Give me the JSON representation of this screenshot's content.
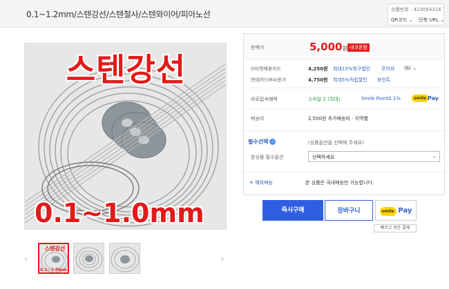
{
  "header": {
    "title": "0.1~1.2mm/스텐강선/스텐철사/스텐와이어/피아노선",
    "product_no": "상품번호 : 423054316",
    "qr_label": "QR코드 ⌄",
    "url_label": "단축 URL ⌄"
  },
  "main_image": {
    "title_text": "스텐강선",
    "range_text": "0.1~1.0mm"
  },
  "thumbnails": {
    "prev": "‹",
    "next": "›",
    "first_title": "스텐강선",
    "first_range": "0.1~1.0mm"
  },
  "info": {
    "price_label": "판매가",
    "price": "5,000",
    "price_unit": "원",
    "coupon": "내쿠폰함",
    "card1_label": "G마켓제휴카드",
    "card1_price": "4,250원",
    "card1_desc": "최대15%청구할인",
    "card1_interest": "무이자",
    "card1_months": "(6) ⌄",
    "card2_label": "현대카드M사용가",
    "card2_price": "4,750원",
    "card2_desc": "최대5%적립할인",
    "card2_point": "포인트",
    "benefit_label": "바로접속혜택",
    "benefit_smile": "스마일 2 (최대)",
    "benefit_point": "Smile Point0.1%",
    "smile_badge": "smile",
    "pay_text": "Pay",
    "shipping_label": "배송비",
    "shipping_value": "2,500원 추가배송비 · 지역별",
    "required_label": "필수선택",
    "required_hint": "(상품옵션을 선택해 주세요)",
    "option_label": "본상품 필수옵션",
    "option_value": "선택하세요",
    "overseas_label": "해외배송",
    "overseas_value": "본 상품은 국내배송만 가능합니다."
  },
  "buttons": {
    "buy": "즉시구매",
    "cart": "장바구니",
    "smile_badge": "smile",
    "pay": "Pay",
    "note": "빠르고 쉬운 결제"
  },
  "colors": {
    "accent": "#e21a1a",
    "primary": "#2f5fe0",
    "link": "#2f5fbf",
    "smile_yellow": "#ffd400"
  }
}
